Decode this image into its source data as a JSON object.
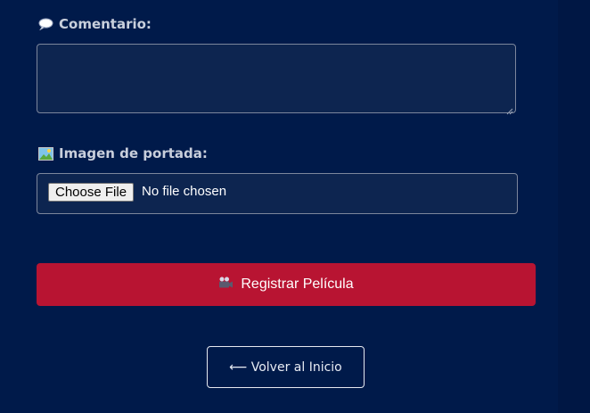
{
  "comment_field": {
    "label": "Comentario:",
    "label_icon": "speech-bubble-icon",
    "value": ""
  },
  "cover_field": {
    "label": "Imagen de portada:",
    "label_icon": "picture-icon",
    "button_label": "Choose File",
    "status": "No file chosen"
  },
  "submit_button": {
    "label": "Registrar Película",
    "icon": "movie-camera-icon"
  },
  "back_button": {
    "label": "⟵ Volver al Inicio",
    "icon": "left-arrow-icon"
  },
  "colors": {
    "background": "#001a4a",
    "field_background": "#0d2550",
    "primary": "#b81432"
  }
}
